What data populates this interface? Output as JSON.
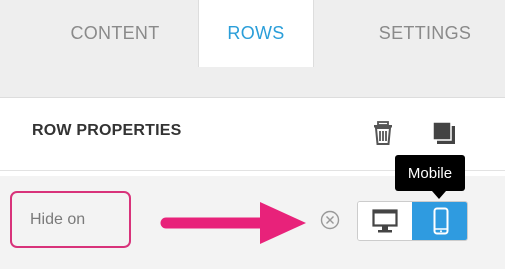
{
  "tabs": [
    {
      "label": "CONTENT",
      "active": false
    },
    {
      "label": "ROWS",
      "active": true
    },
    {
      "label": "SETTINGS",
      "active": false
    }
  ],
  "panel": {
    "title": "ROW PROPERTIES",
    "actions": [
      {
        "icon": "trash-icon"
      },
      {
        "icon": "duplicate-icon"
      }
    ]
  },
  "hide_on": {
    "label": "Hide on",
    "devices": [
      {
        "icon": "desktop-icon",
        "selected": false
      },
      {
        "icon": "mobile-icon",
        "selected": true
      }
    ],
    "tooltip": "Mobile"
  },
  "colors": {
    "accent": "#2f9be0",
    "tab_active_text": "#2a9ed9",
    "annotation": "#d8327a"
  }
}
